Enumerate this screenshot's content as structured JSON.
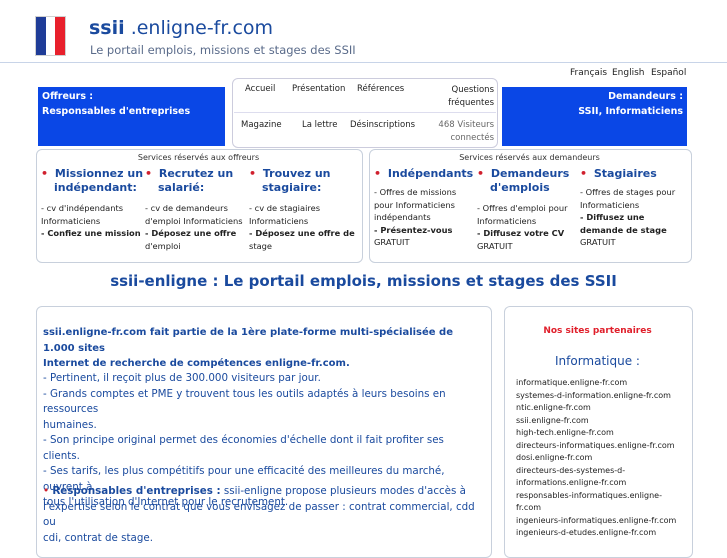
{
  "header": {
    "title_bold": "ssii",
    "title_rest": " .enligne-fr.com",
    "subtitle": "Le portail emplois, missions et stages des SSII",
    "flag_colors": [
      "#1f3c97",
      "#ffffff",
      "#e8202c"
    ]
  },
  "languages": [
    "Français",
    "English",
    "Español"
  ],
  "offreurs": {
    "line1": "Offreurs :",
    "line2": "Responsables d'entreprises"
  },
  "demandeurs": {
    "line1": "Demandeurs :",
    "line2": "SSII, Informaticiens"
  },
  "nav": {
    "accueil": "Accueil",
    "presentation": "Présentation",
    "references": "Références",
    "questions1": "Questions",
    "questions2": "fréquentes",
    "magazine": "Magazine",
    "lettre": "La lettre",
    "desinscriptions": "Désinscriptions",
    "visitors1": "468 Visiteurs",
    "visitors2": "connectés"
  },
  "services_offreurs": {
    "title": "Services réservés aux offreurs",
    "col1": {
      "head1": "Missionnez un",
      "head2": "indépendant:",
      "t1": "- cv d'indépendants",
      "t2": "Informaticiens",
      "t3": "- Confiez une mission"
    },
    "col2": {
      "head1": "Recrutez un",
      "head2": "salarié:",
      "t1": "- cv de demandeurs",
      "t2": "d'emploi Informaticiens",
      "t3": "- Déposez une offre",
      "t4": "d'emploi"
    },
    "col3": {
      "head1": "Trouvez un",
      "head2": "stagiaire:",
      "t1": "- cv de stagiaires",
      "t2": "Informaticiens",
      "t3": "- Déposez une offre de",
      "t4": "stage"
    }
  },
  "services_demandeurs": {
    "title": "Services réservés aux demandeurs",
    "col1": {
      "head1": "Indépendants",
      "t1": "- Offres de missions",
      "t2": "pour Informaticiens",
      "t3": "indépendants",
      "t4": "- Présentez-vous",
      "t5": "GRATUIT"
    },
    "col2": {
      "head1": "Demandeurs",
      "head2": "d'emplois",
      "t1": "- Offres d'emploi pour",
      "t2": "Informaticiens",
      "t3": "- Diffusez votre CV",
      "t4": "GRATUIT"
    },
    "col3": {
      "head1": "Stagiaires",
      "t1": "- Offres de stages pour",
      "t2": "Informaticiens",
      "t3": "- Diffusez une",
      "t4": "demande de stage",
      "t5": "GRATUIT"
    }
  },
  "main": {
    "heading": "ssii-enligne : Le portail emplois, missions et stages des SSII",
    "intro1": "ssii.enligne-fr.com fait partie de la 1ère plate-forme multi-spécialisée de 1.000 sites",
    "intro2": "Internet de recherche de compétences enligne-fr.com.",
    "p1": "- Pertinent, il reçoit plus de 300.000 visiteurs par jour.",
    "p2a": "- Grands comptes et PME y trouvent tous les outils adaptés à leurs besoins en ressources",
    "p2b": "humaines.",
    "p3": "- Son principe original permet des économies d'échelle dont il fait profiter ses clients.",
    "p4a": "- Ses tarifs, les plus compétitifs pour une efficacité des meilleures du marché, ouvrent à",
    "p4b": "tous l'utilisation d'Internet pour le recrutement.",
    "resp_label": "Responsables d'entreprises :",
    "resp_a": " ssii-enligne propose plusieurs modes d'accès à",
    "resp_b": "l'expertise selon le contrat que vous envisagez de passer : contrat commercial, cdd ou",
    "resp_c": "cdi, contrat de stage."
  },
  "partners": {
    "title": "Nos sites partenaires",
    "category": "Informatique :",
    "sites": [
      "informatique.enligne-fr.com",
      "systemes-d-information.enligne-fr.com",
      "ntic.enligne-fr.com",
      "ssii.enligne-fr.com",
      "high-tech.enligne-fr.com",
      "directeurs-informatiques.enligne-fr.com",
      "dosi.enligne-fr.com",
      "directeurs-des-systemes-d-",
      "informations.enligne-fr.com",
      "responsables-informatiques.enligne-",
      "fr.com",
      "ingenieurs-informatiques.enligne-fr.com",
      "ingenieurs-d-etudes.enligne-fr.com"
    ]
  }
}
